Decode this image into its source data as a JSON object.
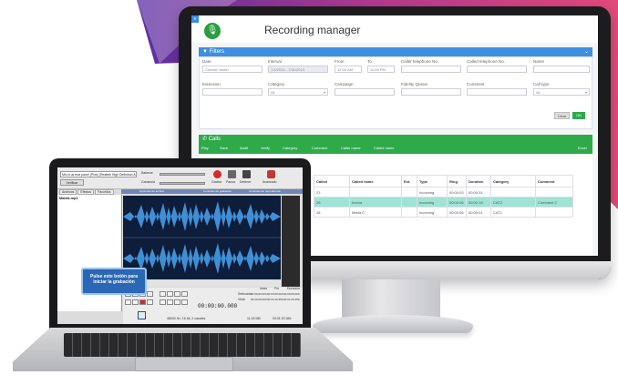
{
  "recording_manager": {
    "title": "Recording manager",
    "filters": {
      "heading": "Filters",
      "date_label": "Date",
      "date_value": "Current month",
      "interval_label": "Interval",
      "interval_value": "7/1/2015 - 7/31/2015",
      "from_label": "From",
      "from_value": "12:00 AM",
      "to_label": "To",
      "to_value": "11:59 PM",
      "caller_label": "Caller telephone No.",
      "called_label": "Called telephone No.",
      "name_label": "Name",
      "extension_label": "Extension",
      "category_label": "Category",
      "category_value": "All",
      "campaign_label": "Campaign",
      "fidelity_label": "Fidelity Queue",
      "comment_label": "Comment",
      "calltype_label": "Call type",
      "calltype_value": "All",
      "clear_label": "Clear",
      "ok_label": "OK"
    },
    "calls": {
      "heading": "Calls",
      "toolbar": [
        "Play",
        "Save",
        "Audit",
        "Verify",
        "Category",
        "Comment",
        "Caller name",
        "Called name"
      ],
      "excel_label": "Excel",
      "columns": [
        "Called",
        "Called name",
        "Ext.",
        "Type",
        "Ring",
        "Duration",
        "Category",
        "Comment"
      ],
      "rows": [
        [
          "23",
          "",
          "",
          "Incoming",
          "00:00:03",
          "00:00:31",
          "",
          ""
        ],
        [
          "26",
          "Imena",
          "",
          "Incoming",
          "00:00:06",
          "00:00:18",
          "CAT2",
          "Comment 2"
        ],
        [
          "28",
          "Marta C",
          "",
          "Incoming",
          "00:00:06",
          "00:00:01",
          "CAT1",
          ""
        ]
      ]
    }
  },
  "audio_editor": {
    "device_select": "Mic in at rear panel (Pink) (Realtek High Definition Audi",
    "config_button": "Verificar",
    "balance_label": "Balance",
    "volume_label": "Ganancia",
    "record_label": "Grabar",
    "pause_label": "Pausa",
    "stop_label": "Detener",
    "advanced_label": "Avanzado",
    "tabs": [
      "Archivos",
      "Efectos",
      "Favoritos"
    ],
    "file_name": "Maialk.mp3",
    "bar_labels": [
      "Opciones de archivo",
      "Controles de grabación",
      "Controles de reproducción"
    ],
    "timecode": "00:00:00.000",
    "selection_label": "Selección",
    "view_label": "Vista",
    "start_label": "Inicio",
    "end_label": "Fin",
    "duration_label": "Duración",
    "selection_times": [
      "00:00:00.000",
      "00:00:00.000",
      "00:00:00.000"
    ],
    "view_times": [
      "00:00:00.000",
      "00:01:20.356",
      "00:01:20.356"
    ],
    "status_info": "48000 Hz, 16 bit, 2 canales",
    "status_size": "11,03 MB",
    "status_time": "00:01:20.356",
    "tooltip": "Pulse este botón para iniciar la grabación"
  }
}
